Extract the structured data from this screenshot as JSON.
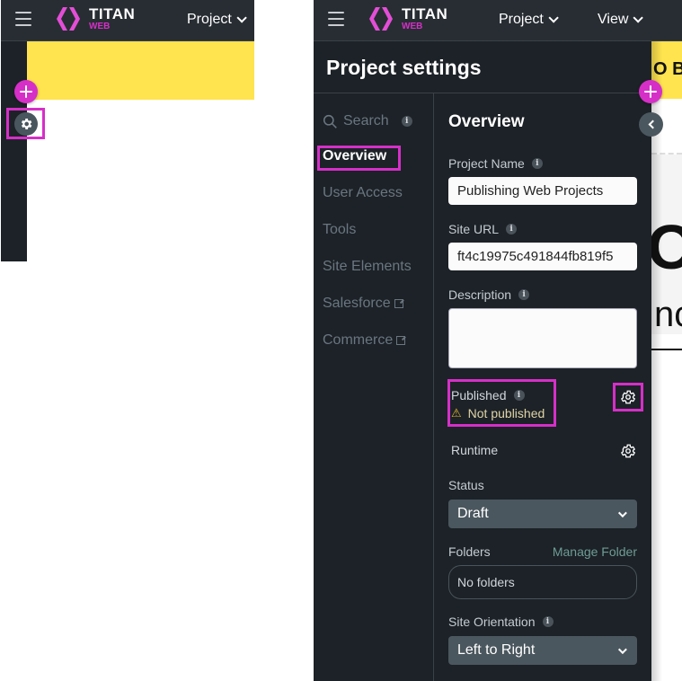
{
  "brand": {
    "title": "TITAN",
    "subtitle": "WEB",
    "accent_color": "#d62fc8"
  },
  "left_view": {
    "menus": [
      {
        "label": "Project"
      }
    ],
    "sidebar_buttons": [
      {
        "icon": "plus-icon"
      },
      {
        "icon": "gear-icon",
        "highlighted": true
      }
    ]
  },
  "right_view": {
    "menus": [
      {
        "label": "Project"
      },
      {
        "label": "View"
      }
    ],
    "canvas_preview_text": "O BI",
    "canvas_big_letter": "O",
    "canvas_fragment": "nc",
    "settings": {
      "title": "Project settings",
      "search": {
        "label": "Search",
        "info": "i"
      },
      "nav": [
        {
          "label": "Overview",
          "active": true,
          "highlighted": true
        },
        {
          "label": "User Access"
        },
        {
          "label": "Tools"
        },
        {
          "label": "Site Elements"
        },
        {
          "label": "Salesforce",
          "external": true
        },
        {
          "label": "Commerce",
          "external": true
        }
      ],
      "overview": {
        "title": "Overview",
        "project_name": {
          "label": "Project Name",
          "value": "Publishing Web Projects"
        },
        "site_url": {
          "label": "Site URL",
          "value": "ft4c19975c491844fb819f5"
        },
        "description": {
          "label": "Description",
          "value": ""
        },
        "published": {
          "label": "Published",
          "status": "Not published",
          "status_color": "#e3b22d"
        },
        "runtime": {
          "label": "Runtime"
        },
        "status": {
          "label": "Status",
          "value": "Draft"
        },
        "folders": {
          "label": "Folders",
          "manage_label": "Manage Folder",
          "value": "No folders"
        },
        "site_orientation": {
          "label": "Site Orientation",
          "value": "Left to Right"
        }
      }
    }
  },
  "info_glyph": "i",
  "warning_glyph": "⚠"
}
